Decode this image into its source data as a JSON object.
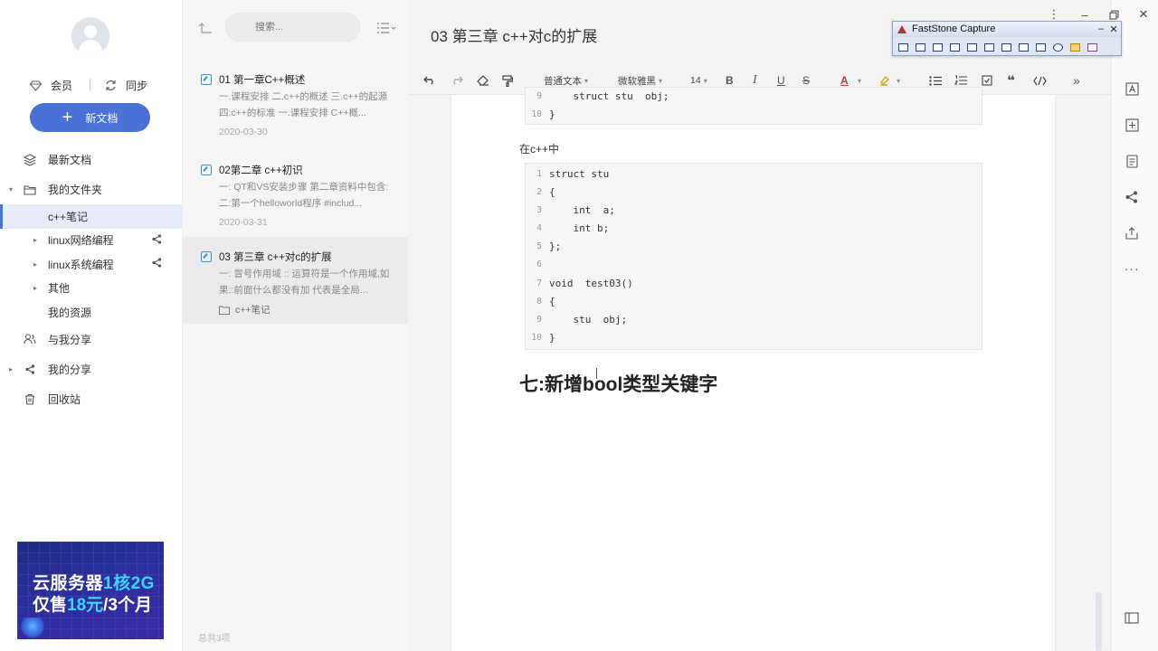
{
  "sidebar": {
    "vip_label": "会员",
    "sync_label": "同步",
    "new_doc_label": "新文档",
    "items": [
      {
        "label": "最新文档",
        "icon": "layers-icon"
      },
      {
        "label": "我的文件夹",
        "icon": "folder-icon"
      },
      {
        "label": "c++笔记",
        "icon": ""
      },
      {
        "label": "linux网络编程",
        "icon": "share-icon"
      },
      {
        "label": "linux系统编程",
        "icon": "share-icon"
      },
      {
        "label": "其他",
        "icon": ""
      },
      {
        "label": "我的资源",
        "icon": ""
      },
      {
        "label": "与我分享",
        "icon": "users-icon"
      },
      {
        "label": "我的分享",
        "icon": "share-icon"
      },
      {
        "label": "回收站",
        "icon": "trash-icon"
      }
    ],
    "ad": {
      "line1_a": "云服务器",
      "line1_b": "1核2G",
      "line2_a": "仅售",
      "line2_b": "18元",
      "line2_c": "/3个月"
    }
  },
  "doc_list": {
    "search_placeholder": "搜索...",
    "docs": [
      {
        "title": "01 第一章C++概述",
        "summary": "一.课程安排 二.c++的概述 三.c++的起源 四:c++的标准 一.课程安排 C++概...",
        "date": "2020-03-30"
      },
      {
        "title": "02第二章 c++初识",
        "summary": "一: QT和VS安装步骤 第二章资料中包含: 二:第一个helloworld程序 #includ...",
        "date": "2020-03-31"
      },
      {
        "title": "03 第三章 c++对c的扩展",
        "summary": "一: 冒号作用域 :: 运算符是一个作用域,如果::前面什么都没有加 代表是全局...",
        "folder": "c++笔记"
      }
    ],
    "footer": "总共3项"
  },
  "editor": {
    "title": "03 第三章 c++对c的扩展",
    "toolbar": {
      "style": "普通文本",
      "font": "微软雅黑",
      "size": "14"
    },
    "top_code": [
      {
        "ln": "9",
        "code": "    struct stu  obj;"
      },
      {
        "ln": "10",
        "code": "}"
      }
    ],
    "paragraph": "在c++中",
    "code": [
      {
        "ln": "1",
        "code": "struct stu"
      },
      {
        "ln": "2",
        "code": "{"
      },
      {
        "ln": "3",
        "code": "    int  a;"
      },
      {
        "ln": "4",
        "code": "    int b;"
      },
      {
        "ln": "5",
        "code": "};"
      },
      {
        "ln": "6",
        "code": ""
      },
      {
        "ln": "7",
        "code": "void  test03()"
      },
      {
        "ln": "8",
        "code": "{"
      },
      {
        "ln": "9",
        "code": "    stu  obj;"
      },
      {
        "ln": "10",
        "code": "}"
      }
    ],
    "heading": "七:新增bool类型关键字"
  },
  "faststone": {
    "title": "FastStone Capture"
  },
  "colors": {
    "accent": "#4a71d6",
    "code_bg": "#f6f6f6",
    "keyword": "#4d5fa8",
    "function": "#c0454a"
  }
}
